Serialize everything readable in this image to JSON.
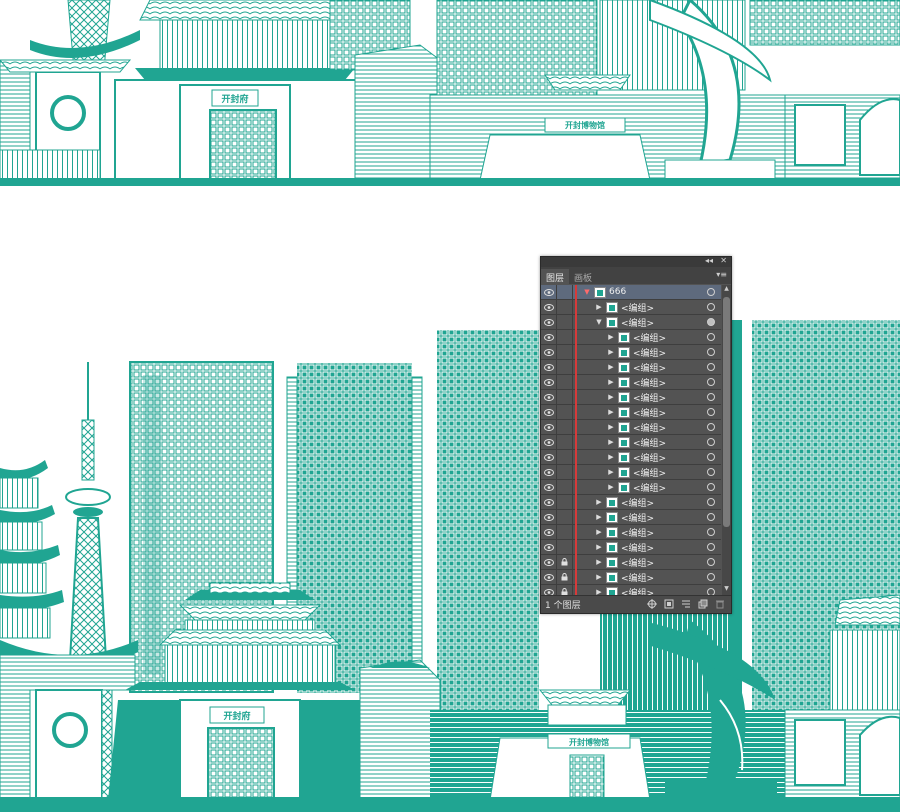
{
  "colors": {
    "teal": "#20a592",
    "white": "#ffffff",
    "panel": "#535353",
    "selection": "#5e6a7d",
    "layer_color": "#d63a3a"
  },
  "artwork": {
    "top_strip": {
      "gate_sign": "开封府",
      "museum_sign": "开封博物馆"
    },
    "main": {
      "gate_sign": "开封府",
      "museum_sign": "开封博物馆"
    }
  },
  "layers_panel": {
    "controls": {
      "collapse": "◂◂",
      "close": "✕"
    },
    "tabs": [
      {
        "label": "图层",
        "active": true
      },
      {
        "label": "画板",
        "active": false
      }
    ],
    "menu_icon": "panel-menu-icon",
    "rows": [
      {
        "name": "666",
        "depth": 0,
        "expanded": true,
        "selected": true,
        "locked": false,
        "target_filled": false
      },
      {
        "name": "<编组>",
        "depth": 1,
        "expanded": false,
        "selected": false,
        "locked": false,
        "target_filled": false
      },
      {
        "name": "<编组>",
        "depth": 1,
        "expanded": true,
        "selected": false,
        "locked": false,
        "target_filled": true
      },
      {
        "name": "<编组>",
        "depth": 2,
        "expanded": false,
        "selected": false,
        "locked": false,
        "target_filled": false
      },
      {
        "name": "<编组>",
        "depth": 2,
        "expanded": false,
        "selected": false,
        "locked": false,
        "target_filled": false
      },
      {
        "name": "<编组>",
        "depth": 2,
        "expanded": false,
        "selected": false,
        "locked": false,
        "target_filled": false
      },
      {
        "name": "<编组>",
        "depth": 2,
        "expanded": false,
        "selected": false,
        "locked": false,
        "target_filled": false
      },
      {
        "name": "<编组>",
        "depth": 2,
        "expanded": false,
        "selected": false,
        "locked": false,
        "target_filled": false
      },
      {
        "name": "<编组>",
        "depth": 2,
        "expanded": false,
        "selected": false,
        "locked": false,
        "target_filled": false
      },
      {
        "name": "<编组>",
        "depth": 2,
        "expanded": false,
        "selected": false,
        "locked": false,
        "target_filled": false
      },
      {
        "name": "<编组>",
        "depth": 2,
        "expanded": false,
        "selected": false,
        "locked": false,
        "target_filled": false
      },
      {
        "name": "<编组>",
        "depth": 2,
        "expanded": false,
        "selected": false,
        "locked": false,
        "target_filled": false
      },
      {
        "name": "<编组>",
        "depth": 2,
        "expanded": false,
        "selected": false,
        "locked": false,
        "target_filled": false
      },
      {
        "name": "<编组>",
        "depth": 2,
        "expanded": false,
        "selected": false,
        "locked": false,
        "target_filled": false
      },
      {
        "name": "<编组>",
        "depth": 1,
        "expanded": false,
        "selected": false,
        "locked": false,
        "target_filled": false
      },
      {
        "name": "<编组>",
        "depth": 1,
        "expanded": false,
        "selected": false,
        "locked": false,
        "target_filled": false
      },
      {
        "name": "<编组>",
        "depth": 1,
        "expanded": false,
        "selected": false,
        "locked": false,
        "target_filled": false
      },
      {
        "name": "<编组>",
        "depth": 1,
        "expanded": false,
        "selected": false,
        "locked": false,
        "target_filled": false
      },
      {
        "name": "<编组>",
        "depth": 1,
        "expanded": false,
        "selected": false,
        "locked": true,
        "target_filled": false
      },
      {
        "name": "<编组>",
        "depth": 1,
        "expanded": false,
        "selected": false,
        "locked": true,
        "target_filled": false
      },
      {
        "name": "<编组>",
        "depth": 1,
        "expanded": false,
        "selected": false,
        "locked": true,
        "target_filled": false
      }
    ],
    "footer": {
      "layer_count": "1 个图层",
      "icons": [
        "locate-object-icon",
        "make-clipping-mask-icon",
        "new-sublayer-icon",
        "new-layer-icon",
        "delete-layer-icon"
      ]
    }
  }
}
